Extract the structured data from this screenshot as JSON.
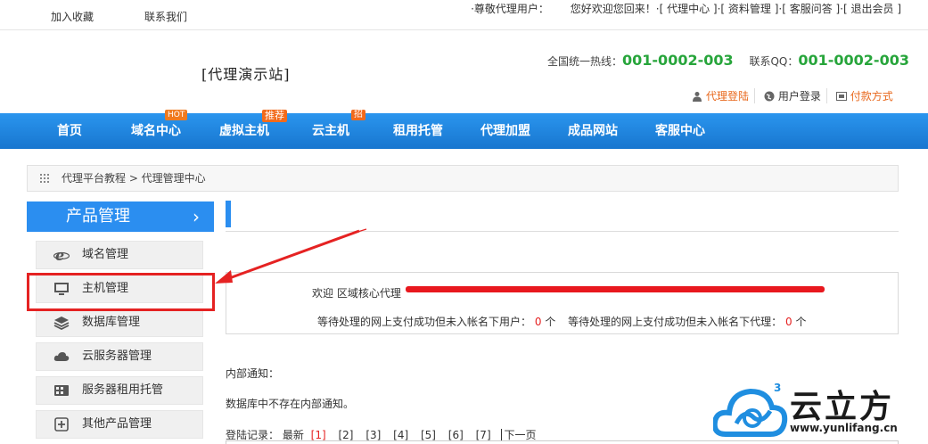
{
  "topbar": {
    "favorite": "加入收藏",
    "contact": "联系我们",
    "greeting_prefix": "·尊敬代理用户：",
    "greeting": "您好欢迎您回来！·[ 代理中心 ]·[ 资料管理 ]·[ 客服问答 ]·[ 退出会员 ]"
  },
  "header": {
    "logo": "[代理演示站]",
    "hotline_label": "全国统一热线：",
    "hotline": "001-0002-003",
    "qq_label": "联系QQ：",
    "qq": "001-0002-003",
    "agent_login": "代理登陆",
    "user_login": "用户登录",
    "payment": "付款方式"
  },
  "nav": {
    "items": [
      "首页",
      "域名中心",
      "虚拟主机",
      "云主机",
      "租用托管",
      "代理加盟",
      "成品网站",
      "客服中心"
    ],
    "badges": {
      "hot": "HOT",
      "recommend": "推荐",
      "new": "招"
    }
  },
  "breadcrumb": {
    "text": "代理平台教程  >  代理管理中心"
  },
  "sidebar": {
    "title": "产品管理",
    "items": [
      {
        "label": "域名管理",
        "icon": "ie-icon"
      },
      {
        "label": "主机管理",
        "icon": "monitor-icon"
      },
      {
        "label": "数据库管理",
        "icon": "layers-icon"
      },
      {
        "label": "云服务器管理",
        "icon": "cloud-icon"
      },
      {
        "label": "服务器租用托管",
        "icon": "server-icon"
      },
      {
        "label": "其他产品管理",
        "icon": "plus-box-icon"
      }
    ]
  },
  "main": {
    "welcome": "欢迎   区域核心代理",
    "pending_users_label": "等待处理的网上支付成功但未入帐名下用户：",
    "pending_users": "0",
    "pending_agents_label": "等待处理的网上支付成功但未入帐名下代理：",
    "pending_agents": "0",
    "unit": "个",
    "notice_label": "内部通知：",
    "notice_text": "数据库中不存在内部通知。",
    "login_label": "登陆记录：  最新",
    "pages": [
      "[1]",
      "[2]",
      "[3]",
      "[4]",
      "[5]",
      "[6]",
      "[7]"
    ],
    "next": "下一页"
  },
  "watermark": {
    "name": "云立方",
    "url": "www.yunlifang.cn"
  },
  "colors": {
    "nav_blue": "#1e86e0",
    "green": "#27a53b",
    "orange": "#e8671b",
    "red": "#e52222"
  }
}
